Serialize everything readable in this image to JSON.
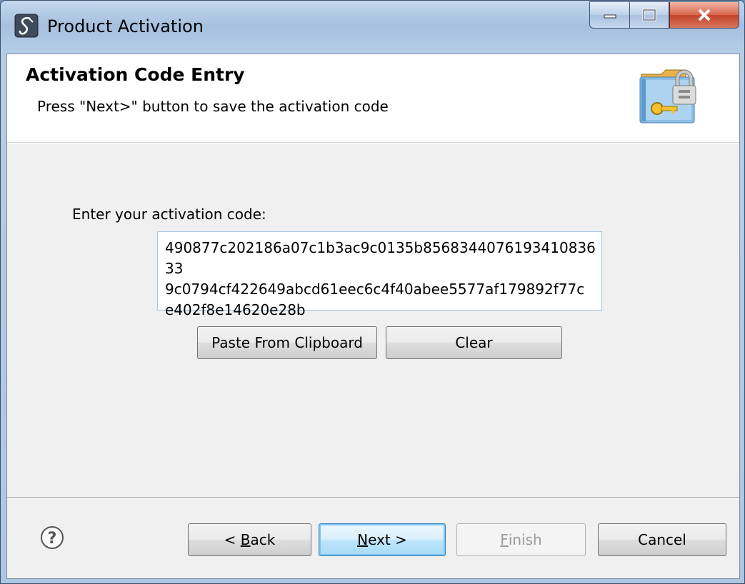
{
  "window": {
    "title": "Product Activation",
    "controls": {
      "minimize": "minimize",
      "maximize": "maximize",
      "close": "close"
    }
  },
  "banner": {
    "title": "Activation Code Entry",
    "description": "Press \"Next>\" button to save the activation code",
    "icon": "folder-lock-key-icon"
  },
  "activation": {
    "label": "Enter your activation code:",
    "code": "490877c202186a07c1b3ac9c0135b856834407619341083633 9c0794cf422649abcd61eec6c4f40abee5577af179892f77c e402f8e14620e28b",
    "code_lines": [
      "490877c202186a07c1b3ac9c0135b856834407619341083633",
      "9c0794cf422649abcd61eec6c4f40abee5577af179892f77c",
      "e402f8e14620e28b"
    ],
    "paste_button": "Paste From Clipboard",
    "clear_button": "Clear"
  },
  "footer": {
    "help_icon": "help-icon",
    "back_prefix": "< ",
    "back_mnemonic": "B",
    "back_rest": "ack",
    "next_mnemonic": "N",
    "next_rest": "ext >",
    "finish_mnemonic": "F",
    "finish_rest": "inish",
    "cancel": "Cancel"
  }
}
